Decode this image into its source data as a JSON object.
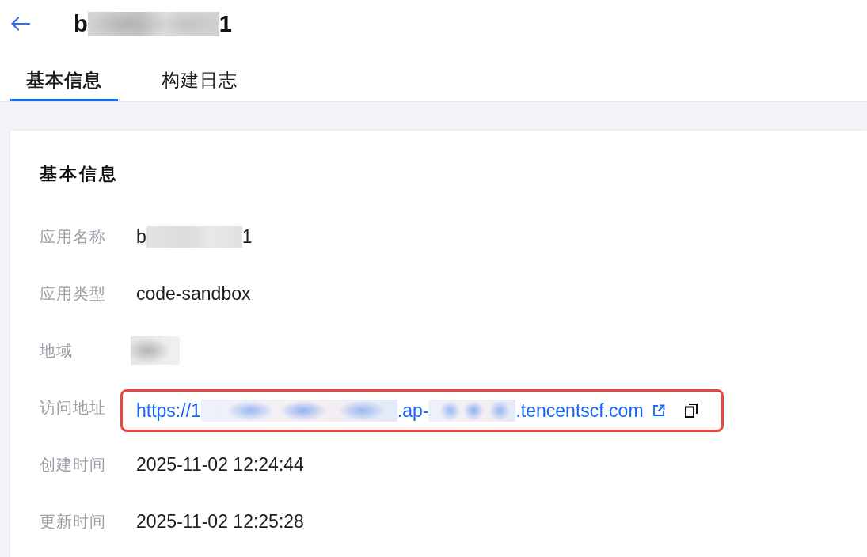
{
  "title": [
    {
      "kind": "text",
      "text": "b"
    },
    {
      "kind": "redacted"
    },
    {
      "kind": "text",
      "text": "1"
    }
  ],
  "tabs": [
    {
      "label": "基本信息",
      "selected": true
    },
    {
      "label": "构建日志",
      "selected": false
    }
  ],
  "card": {
    "title": "基本信息",
    "fields": [
      {
        "label": "应用名称",
        "kind": "plain",
        "highlighted": false,
        "value": [
          {
            "kind": "text",
            "text": "b"
          },
          {
            "kind": "redacted"
          },
          {
            "kind": "text",
            "text": "1"
          }
        ]
      },
      {
        "label": "应用类型",
        "kind": "plain",
        "highlighted": false,
        "value": [
          {
            "kind": "text",
            "text": "code-sandbox"
          }
        ]
      },
      {
        "label": "地域",
        "kind": "plain",
        "highlighted": false,
        "value": [
          {
            "kind": "redacted"
          }
        ]
      },
      {
        "label": "访问地址",
        "kind": "link",
        "highlighted": true,
        "value": [
          {
            "kind": "text",
            "text": "https://1"
          },
          {
            "kind": "redacted"
          },
          {
            "kind": "text",
            "text": ".ap-"
          },
          {
            "kind": "redacted"
          },
          {
            "kind": "text",
            "text": ".tencentscf.com"
          }
        ]
      },
      {
        "label": "创建时间",
        "kind": "plain",
        "highlighted": false,
        "value": [
          {
            "kind": "text",
            "text": "2025-11-02 12:24:44"
          }
        ]
      },
      {
        "label": "更新时间",
        "kind": "plain",
        "highlighted": false,
        "value": [
          {
            "kind": "text",
            "text": "2025-11-02 12:25:28"
          }
        ]
      }
    ]
  }
}
